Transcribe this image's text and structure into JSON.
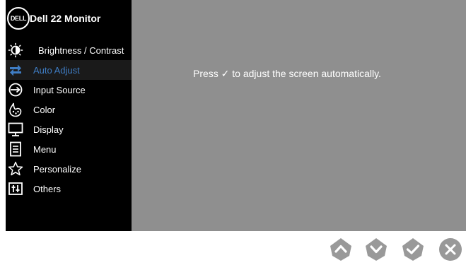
{
  "header": {
    "logo_text": "DELL",
    "model_title": "Dell 22 Monitor"
  },
  "menu": {
    "items": [
      {
        "label": "Brightness / Contrast",
        "icon": "brightness-icon",
        "selected": false
      },
      {
        "label": "Auto Adjust",
        "icon": "auto-adjust-icon",
        "selected": true
      },
      {
        "label": "Input Source",
        "icon": "input-source-icon",
        "selected": false
      },
      {
        "label": "Color",
        "icon": "color-icon",
        "selected": false
      },
      {
        "label": "Display",
        "icon": "display-icon",
        "selected": false
      },
      {
        "label": "Menu",
        "icon": "menu-icon",
        "selected": false
      },
      {
        "label": "Personalize",
        "icon": "star-icon",
        "selected": false
      },
      {
        "label": "Others",
        "icon": "others-icon",
        "selected": false
      }
    ]
  },
  "content": {
    "message": "Press ✓ to adjust the screen automatically."
  },
  "buttons": [
    {
      "name": "up-button",
      "icon": "chevron-up-icon"
    },
    {
      "name": "down-button",
      "icon": "chevron-down-icon"
    },
    {
      "name": "confirm-button",
      "icon": "checkmark-icon"
    },
    {
      "name": "exit-button",
      "icon": "close-icon"
    }
  ],
  "colors": {
    "sidebar_bg": "#000000",
    "content_bg": "#8f8f8f",
    "selected_text": "#3f7dc4",
    "button_fill": "#999999"
  }
}
